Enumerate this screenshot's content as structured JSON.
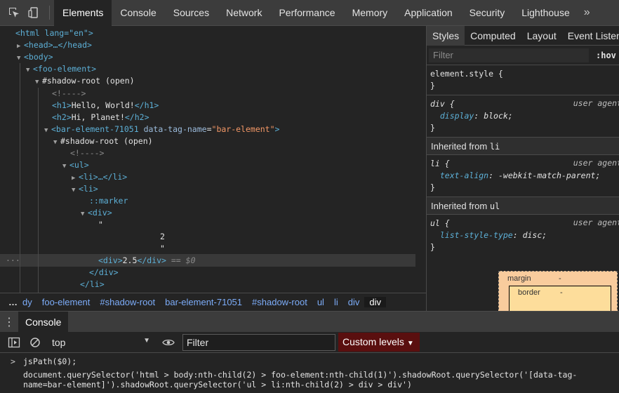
{
  "toolbar": {
    "tabs": [
      "Elements",
      "Console",
      "Sources",
      "Network",
      "Performance",
      "Memory",
      "Application",
      "Security",
      "Lighthouse"
    ],
    "active_tab": "Elements",
    "more": "»"
  },
  "tree": {
    "html_open": "<html lang=\"en\">",
    "head": "<head>…</head>",
    "body_open": "<body>",
    "foo_open": "<foo-element>",
    "shadow1": "#shadow-root (open)",
    "comment1": "<!---->",
    "h1_open": "<h1>",
    "h1_text": "Hello, World!",
    "h1_close": "</h1>",
    "h2_open": "<h2>",
    "h2_text": "Hi, Planet!",
    "h2_close": "</h2>",
    "bar_tag": "<bar-element-71051",
    "bar_attr": "data-tag-name",
    "bar_val": "\"bar-element\"",
    "bar_end": ">",
    "shadow2": "#shadow-root (open)",
    "comment2": "<!---->",
    "ul_open": "<ul>",
    "li_collapsed": "<li>…</li>",
    "li_open": "<li>",
    "marker": "::marker",
    "div_open": "<div>",
    "quote_open": "\"",
    "text_2": "2",
    "quote_close": "\"",
    "sel_div_open": "<div>",
    "sel_div_text": "2.5",
    "sel_div_close": "</div>",
    "sel_eq": " == ",
    "sel_var": "$0",
    "div_close": "</div>",
    "li_close": "</li>",
    "ellipsis": "···"
  },
  "breadcrumbs": {
    "more": "…",
    "items": [
      "dy",
      "foo-element",
      "#shadow-root",
      "bar-element-71051",
      "#shadow-root",
      "ul",
      "li",
      "div",
      "div"
    ]
  },
  "styles": {
    "tabs": [
      "Styles",
      "Computed",
      "Layout",
      "Event Listeners"
    ],
    "filter_placeholder": "Filter",
    "hov": ":hov",
    "element_style": "element.style {",
    "close_brace": "}",
    "rules": [
      {
        "selector": "div {",
        "source": "user agent",
        "prop": "display",
        "value": "block;"
      },
      {
        "inherited": "Inherited from",
        "inherited_tag": "li",
        "selector": "li {",
        "source": "user agent",
        "prop": "text-align",
        "value": "-webkit-match-parent;"
      },
      {
        "inherited": "Inherited from",
        "inherited_tag": "ul",
        "selector": "ul {",
        "source": "user agent",
        "prop": "list-style-type",
        "value": "disc;"
      }
    ],
    "box": {
      "margin": "margin",
      "margin_val": "-",
      "border": "border",
      "border_val": "-"
    }
  },
  "drawer": {
    "tab": "Console",
    "context": "top",
    "filter_value": "Filter",
    "levels": "Custom levels",
    "prompt": ">",
    "input": "jsPath($0);",
    "output_line1": "document.querySelector('html > body:nth-child(2) > foo-element:nth-child(1)').shadowRoot.querySelector('[data-tag-",
    "output_line2": "name=bar-element]').shadowRoot.querySelector('ul > li:nth-child(2) > div > div')"
  },
  "colors": {
    "tag": "#5db0d7",
    "attr": "#9bbbdc",
    "value": "#f29766",
    "link": "#7cacf8",
    "levels_bg": "#5a0f0f"
  }
}
